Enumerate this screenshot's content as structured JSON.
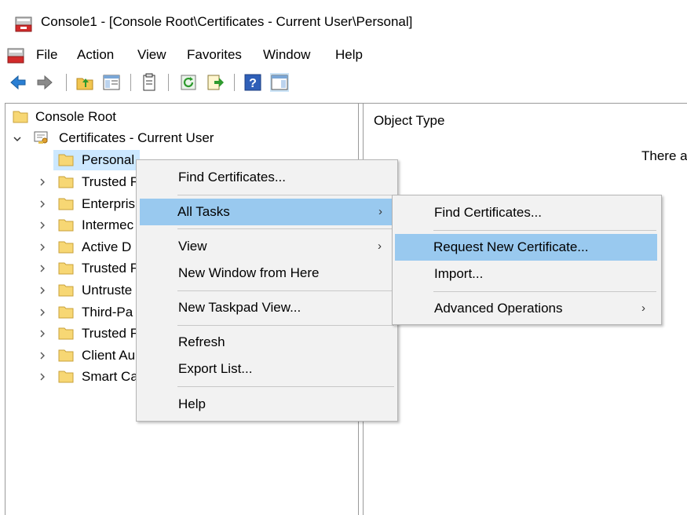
{
  "window": {
    "title": "Console1 - [Console Root\\Certificates - Current User\\Personal]"
  },
  "menubar": [
    "File",
    "Action",
    "View",
    "Favorites",
    "Window",
    "Help"
  ],
  "toolbar": [
    "back-icon",
    "forward-icon",
    "up-folder-icon",
    "show-hide-tree-icon",
    "properties-icon",
    "refresh-icon",
    "export-list-icon",
    "help-icon",
    "show-hide-action-pane-icon"
  ],
  "tree": {
    "root": "Console Root",
    "certs": "Certificates - Current User",
    "items": [
      "Personal",
      "Trusted F",
      "Enterpris",
      "Intermec",
      "Active D",
      "Trusted F",
      "Untruste",
      "Third-Pa",
      "Trusted F",
      "Client Au",
      "Smart Ca"
    ]
  },
  "right_pane": {
    "column_header": "Object Type",
    "message": "There a"
  },
  "context_menu": {
    "find": "Find Certificates...",
    "all_tasks": "All Tasks",
    "view": "View",
    "new_window": "New Window from Here",
    "new_taskpad": "New Taskpad View...",
    "refresh": "Refresh",
    "export": "Export List...",
    "help": "Help"
  },
  "submenu": {
    "find": "Find Certificates...",
    "request": "Request New Certificate...",
    "import": "Import...",
    "advanced": "Advanced Operations"
  },
  "colors": {
    "highlight": "#99c9ef",
    "selected_item": "#cce8ff",
    "menu_bg": "#f2f2f2"
  }
}
